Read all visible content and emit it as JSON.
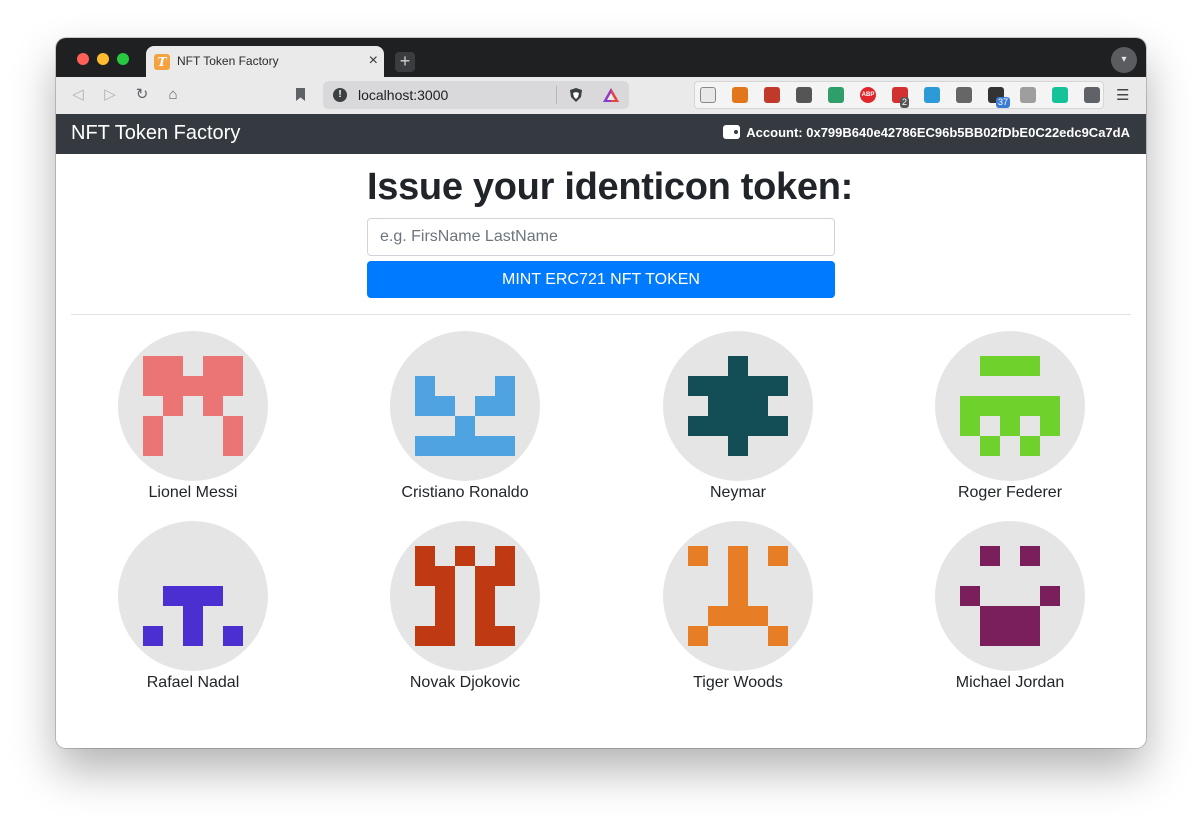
{
  "browser": {
    "tab_title": "NFT Token Factory",
    "tab_favicon_letter": "T",
    "tab_close": "×",
    "new_tab": "+",
    "url": "localhost:3000",
    "extensions": [
      {
        "name": "reader-mode-icon",
        "color": "#e8e8e8"
      },
      {
        "name": "metamask-fox-icon",
        "color": "#e2761b"
      },
      {
        "name": "extension-red-icon",
        "color": "#c0392b"
      },
      {
        "name": "extension-s-icon",
        "color": "#555555"
      },
      {
        "name": "extension-green-circle-icon",
        "color": "#2e9e6a"
      },
      {
        "name": "adblock-plus-icon",
        "color": "#e0262a",
        "text": "ABP"
      },
      {
        "name": "extension-dots-icon",
        "color": "#d33131",
        "badge": "2",
        "badge_color": "#555555"
      },
      {
        "name": "extension-window-icon",
        "color": "#2b9ad6"
      },
      {
        "name": "eyedropper-icon",
        "color": "#666666"
      },
      {
        "name": "extension-triangle-icon",
        "color": "#333333",
        "badge": "37",
        "badge_color": "#3a7bd5"
      },
      {
        "name": "tomato-icon",
        "color": "#9e9e9e"
      },
      {
        "name": "grammarly-icon",
        "color": "#15c39a"
      },
      {
        "name": "puzzle-extensions-icon",
        "color": "#5f6368"
      }
    ]
  },
  "app": {
    "brand": "NFT Token Factory",
    "account_label": "Account: 0x799B640e42786EC96b5BB02fDbE0C22edc9Ca7dA"
  },
  "form": {
    "heading": "Issue your identicon token:",
    "placeholder": "e.g. FirsName LastName",
    "value": "",
    "button_label": "MINT ERC721 NFT TOKEN"
  },
  "tokens": [
    {
      "name": "Lionel Messi",
      "color": "#eb7575",
      "pattern": [
        "11011",
        "11111",
        "01010",
        "10001",
        "10001"
      ]
    },
    {
      "name": "Cristiano Ronaldo",
      "color": "#4fa3e0",
      "pattern": [
        "00000",
        "10001",
        "11011",
        "00100",
        "11111"
      ]
    },
    {
      "name": "Neymar",
      "color": "#134e57",
      "pattern": [
        "00100",
        "11111",
        "01110",
        "11111",
        "00100"
      ]
    },
    {
      "name": "Roger Federer",
      "color": "#6fd12b",
      "pattern": [
        "01110",
        "00000",
        "11111",
        "10101",
        "01010"
      ]
    },
    {
      "name": "Rafael Nadal",
      "color": "#4b2fd1",
      "pattern": [
        "00000",
        "00000",
        "01110",
        "00100",
        "10101"
      ]
    },
    {
      "name": "Novak Djokovic",
      "color": "#bf3a12",
      "pattern": [
        "10101",
        "11011",
        "01010",
        "01010",
        "11011"
      ]
    },
    {
      "name": "Tiger Woods",
      "color": "#e77d24",
      "pattern": [
        "10101",
        "00100",
        "00100",
        "01110",
        "10001"
      ]
    },
    {
      "name": "Michael Jordan",
      "color": "#7b1f5c",
      "pattern": [
        "01010",
        "00000",
        "10001",
        "01110",
        "01110"
      ]
    }
  ]
}
